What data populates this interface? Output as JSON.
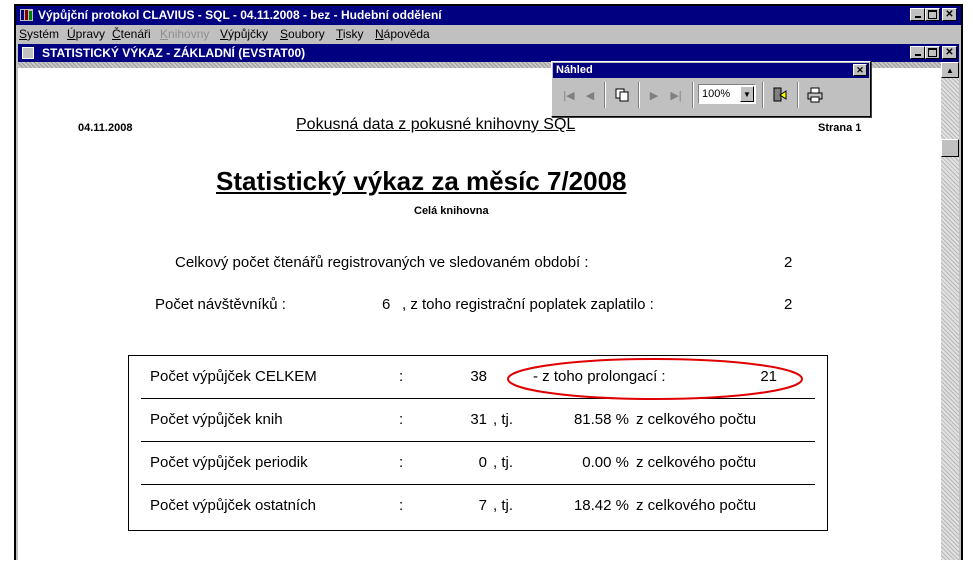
{
  "window": {
    "title": "Výpůjční protokol CLAVIUS - SQL - 04.11.2008 - bez - Hudební oddělení"
  },
  "menu": {
    "items": [
      {
        "label": "Systém",
        "disabled": false
      },
      {
        "label": "Úpravy",
        "disabled": false
      },
      {
        "label": "Čtenáři",
        "disabled": false
      },
      {
        "label": "Knihovny",
        "disabled": true
      },
      {
        "label": "Výpůjčky",
        "disabled": false
      },
      {
        "label": "Soubory",
        "disabled": false
      },
      {
        "label": "Tisky",
        "disabled": false
      },
      {
        "label": "Nápověda",
        "disabled": false
      }
    ]
  },
  "child_window": {
    "title": "STATISTICKÝ VÝKAZ - ZÁKLADNÍ (EVSTAT00)"
  },
  "preview_toolbar": {
    "title": "Náhled",
    "zoom": "100%"
  },
  "report": {
    "date": "04.11.2008",
    "header": "Pokusná data z pokusné knihovny SQL",
    "page_label": "Strana 1",
    "title": "Statistický výkaz za měsíc 7/2008",
    "subtitle": "Celá knihovna",
    "registered_label": "Celkový počet čtenářů registrovaných ve sledovaném období :",
    "registered_value": "2",
    "visitors_label": "Počet návštěvníků :",
    "visitors_value": "6",
    "fee_label": ", z toho registrační poplatek zaplatilo :",
    "fee_value": "2",
    "loans_total": {
      "label": "Počet výpůjček CELKEM",
      "colon": ":",
      "value": "38",
      "prolong_label": "- z toho prolongací :",
      "prolong_value": "21"
    },
    "rows": [
      {
        "label": "Počet výpůjček knih",
        "colon": ":",
        "value": "31",
        "tj": ", tj.",
        "pct": "81.58 %",
        "tail": "z celkového počtu"
      },
      {
        "label": "Počet výpůjček periodik",
        "colon": ":",
        "value": "0",
        "tj": ", tj.",
        "pct": "0.00 %",
        "tail": "z celkového počtu"
      },
      {
        "label": "Počet výpůjček ostatních",
        "colon": ":",
        "value": "7",
        "tj": ", tj.",
        "pct": "18.42 %",
        "tail": "z celkového počtu"
      }
    ]
  },
  "colors": {
    "titlebar": "#000080",
    "face": "#c0c0c0",
    "highlight_ellipse": "#e00000"
  }
}
